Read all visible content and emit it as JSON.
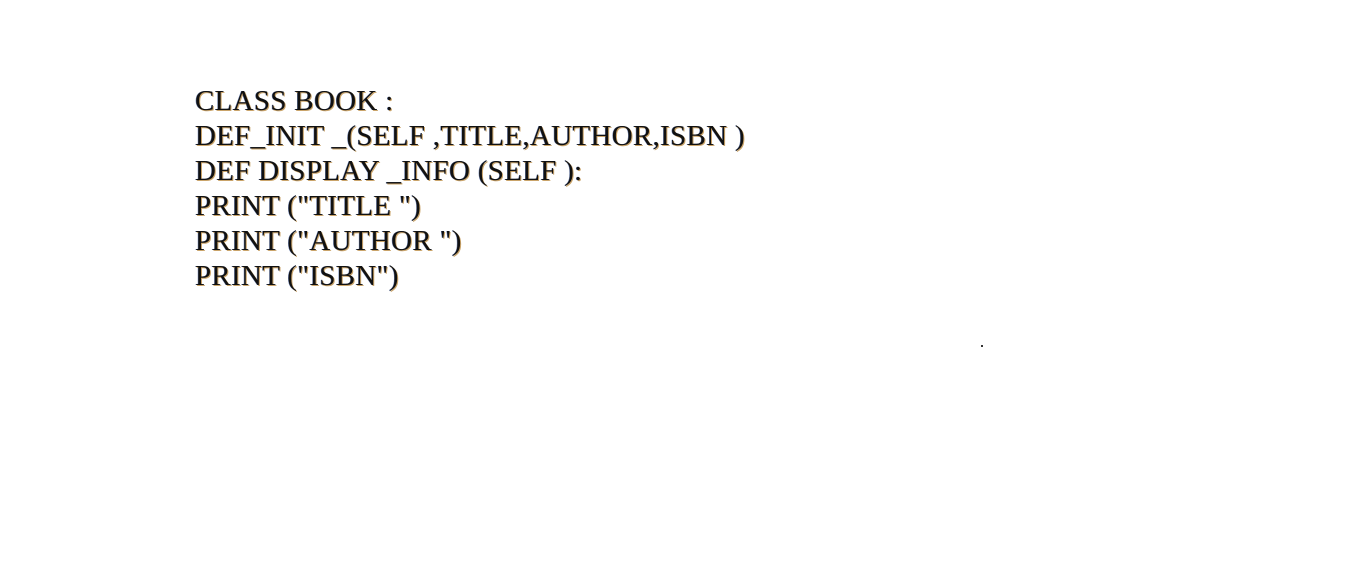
{
  "document": {
    "lines": [
      "CLASS BOOK :",
      "DEF_INIT _(SELF ,TITLE,AUTHOR,ISBN )",
      "DEF DISPLAY _INFO (SELF ):",
      "PRINT (\"TITLE \")",
      "PRINT (\"AUTHOR \")",
      "PRINT (\"ISBN\")"
    ]
  }
}
